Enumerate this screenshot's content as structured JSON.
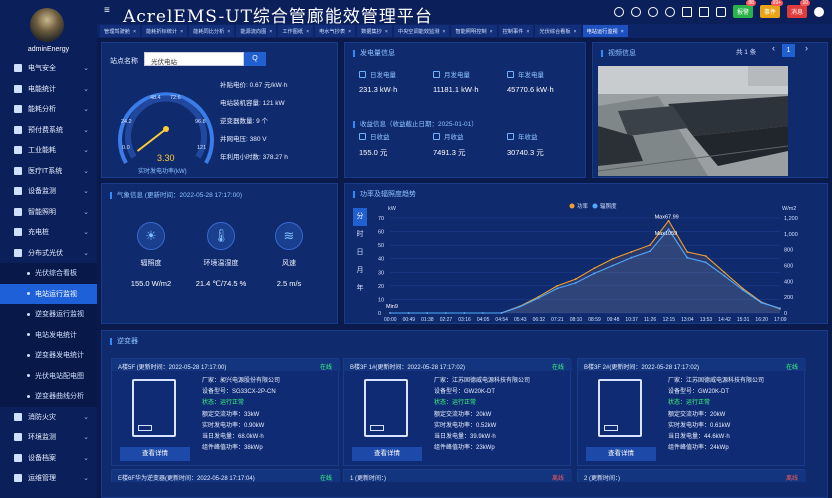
{
  "user": {
    "name": "adminEnergy"
  },
  "app": {
    "title": "AcrelEMS-UT综合管廊能效管理平台"
  },
  "topbar": {
    "buttons": [
      "报警",
      "事件",
      "消息"
    ],
    "badges": [
      "88",
      "99+",
      "10"
    ]
  },
  "sidebar": {
    "items": [
      {
        "label": "电气安全",
        "sub": false
      },
      {
        "label": "电能统计",
        "sub": false
      },
      {
        "label": "能耗分析",
        "sub": false
      },
      {
        "label": "预付费系统",
        "sub": false
      },
      {
        "label": "工业能耗",
        "sub": false
      },
      {
        "label": "医疗IT系统",
        "sub": false
      },
      {
        "label": "设备监测",
        "sub": false
      },
      {
        "label": "智能照明",
        "sub": false
      },
      {
        "label": "充电桩",
        "sub": false
      },
      {
        "label": "分布式光伏",
        "sub": false
      },
      {
        "label": "光伏综合看板",
        "sub": true
      },
      {
        "label": "电站运行监视",
        "sub": true,
        "active": true
      },
      {
        "label": "逆变器运行监视",
        "sub": true
      },
      {
        "label": "电站发电统计",
        "sub": true
      },
      {
        "label": "逆变器发电统计",
        "sub": true
      },
      {
        "label": "光伏电站配电图",
        "sub": true
      },
      {
        "label": "逆变器曲线分析",
        "sub": true
      },
      {
        "label": "消防火灾",
        "sub": false
      },
      {
        "label": "环境监测",
        "sub": false
      },
      {
        "label": "设备档案",
        "sub": false
      },
      {
        "label": "运维管理",
        "sub": false
      }
    ]
  },
  "tabs": [
    "管理驾驶舱",
    "能耗折标统计",
    "能耗同比分析",
    "能源流向图",
    "工作图纸",
    "电水气抄表",
    "数据集抄",
    "中央空调能效监测",
    "智能照明控制",
    "控制事件",
    "光伏综合看板",
    "电站运行监视"
  ],
  "station": {
    "label": "站点名称",
    "value": "光伏电站",
    "search": "Q",
    "gauge_value": "3.30",
    "gauge_caption": "实时发电功率(kW)",
    "gauge_ticks": [
      "0.0",
      "24.2",
      "48.4",
      "72.6",
      "96.8",
      "121"
    ],
    "gauge_fraction": 0.027,
    "facts": [
      "补贴电价: 0.67 元/kW·h",
      "电站装机容量: 121 kW",
      "逆变器数量: 9 个",
      "并网电压: 380 V",
      "年利用小时数: 378.27 h"
    ]
  },
  "gen": {
    "header": "发电量信息",
    "items": [
      {
        "label": "日发电量",
        "value": "231.3 kW·h"
      },
      {
        "label": "月发电量",
        "value": "11181.1 kW·h"
      },
      {
        "label": "年发电量",
        "value": "45770.6 kW·h"
      }
    ]
  },
  "income": {
    "header": "收益信息（收益截止日期：2025-01-01）",
    "items": [
      {
        "label": "日收益",
        "value": "155.0 元"
      },
      {
        "label": "月收益",
        "value": "7491.3 元"
      },
      {
        "label": "年收益",
        "value": "30740.3 元"
      }
    ]
  },
  "video": {
    "header": "视频信息",
    "total": "共 1 条",
    "page": "1",
    "prev": "‹",
    "next": "›"
  },
  "weather": {
    "header": "气象信息 (更新时间：2022-05-28 17:17:00)",
    "items": [
      {
        "name": "辐照度",
        "value": "155.0 W/m2",
        "icon": "sun-panel-icon"
      },
      {
        "name": "环境温湿度",
        "value": "21.4 ℃/74.5 %",
        "icon": "thermometer-icon"
      },
      {
        "name": "风速",
        "value": "2.5 m/s",
        "icon": "wind-icon"
      }
    ]
  },
  "power_chart": {
    "header": "功率及辐照度趋势",
    "vtabs": [
      "分",
      "时",
      "日",
      "月",
      "年"
    ],
    "legend": [
      "功率",
      "辐照度"
    ],
    "left_unit": "kW",
    "right_unit": "W/m2",
    "max1": "Max67.99",
    "max2": "Max1059",
    "min": "Min9"
  },
  "chart_data": {
    "type": "line",
    "x": [
      "00:00",
      "00:49",
      "01:38",
      "02:27",
      "03:16",
      "04:05",
      "04:54",
      "05:43",
      "06:32",
      "07:21",
      "08:10",
      "08:59",
      "09:48",
      "10:37",
      "11:26",
      "12:15",
      "13:04",
      "13:53",
      "14:42",
      "15:31",
      "16:20",
      "17:09"
    ],
    "series": [
      {
        "name": "功率",
        "values": [
          0,
          0,
          0,
          0,
          0,
          0,
          0,
          5,
          12,
          20,
          25,
          33,
          40,
          45,
          50,
          68,
          45,
          42,
          30,
          18,
          8,
          3
        ],
        "color": "#f0a030"
      },
      {
        "name": "辐照度",
        "values": [
          0,
          0,
          0,
          0,
          0,
          0,
          0,
          80,
          190,
          310,
          380,
          500,
          600,
          700,
          780,
          1059,
          700,
          640,
          470,
          290,
          130,
          60
        ],
        "color": "#4fa8ff"
      }
    ],
    "ylim_left": [
      0,
      70
    ],
    "ylim_right": [
      0,
      1200
    ],
    "yticks_left": [
      "0",
      "10",
      "20",
      "30",
      "40",
      "50",
      "60",
      "70"
    ],
    "yticks_right": [
      "0",
      "200",
      "400",
      "600",
      "800",
      "1,000",
      "1,200"
    ],
    "grid": true,
    "legend_position": "top"
  },
  "inverters": {
    "header": "逆变器",
    "cards": [
      {
        "title": "A楼5F (更新时间：2022-05-28 17:17:00)",
        "status": "在线",
        "lines": [
          "厂家：昶兴电源股份有限公司",
          "设备型号：SG33CX-2P-CN",
          "状态：运行正常",
          "额定交流功率：33kW",
          "实时发电功率：0.90kW",
          "当日发电量：68.0kW·h",
          "组件峰值功率：38kWp"
        ],
        "detail": "查看详情"
      },
      {
        "title": "B楼3F 1#(更新时间：2022-05-28 17:17:02)",
        "status": "在线",
        "lines": [
          "厂家：江苏固德威电源科技有限公司",
          "设备型号：GW20K-DT",
          "状态：运行正常",
          "额定交流功率：20kW",
          "实时发电功率：0.52kW",
          "当日发电量：39.9kW·h",
          "组件峰值功率：23kWp"
        ],
        "detail": "查看详情"
      },
      {
        "title": "B楼3F 2#(更新时间：2022-05-28 17:17:02)",
        "status": "在线",
        "lines": [
          "厂家：江苏固德威电源科技有限公司",
          "设备型号：GW20K-DT",
          "状态：运行正常",
          "额定交流功率：20kW",
          "实时发电功率：0.61kW",
          "当日发电量：44.6kW·h",
          "组件峰值功率：24kWp"
        ],
        "detail": "查看详情"
      }
    ],
    "row2": [
      {
        "title": "E楼6F华为逆变器(更新时间：2022-05-28 17:17:04)",
        "status": "在线"
      },
      {
        "title": "1 (更新时间：)",
        "status": "离线"
      },
      {
        "title": "2 (更新时间：)",
        "status": "离线"
      }
    ]
  }
}
